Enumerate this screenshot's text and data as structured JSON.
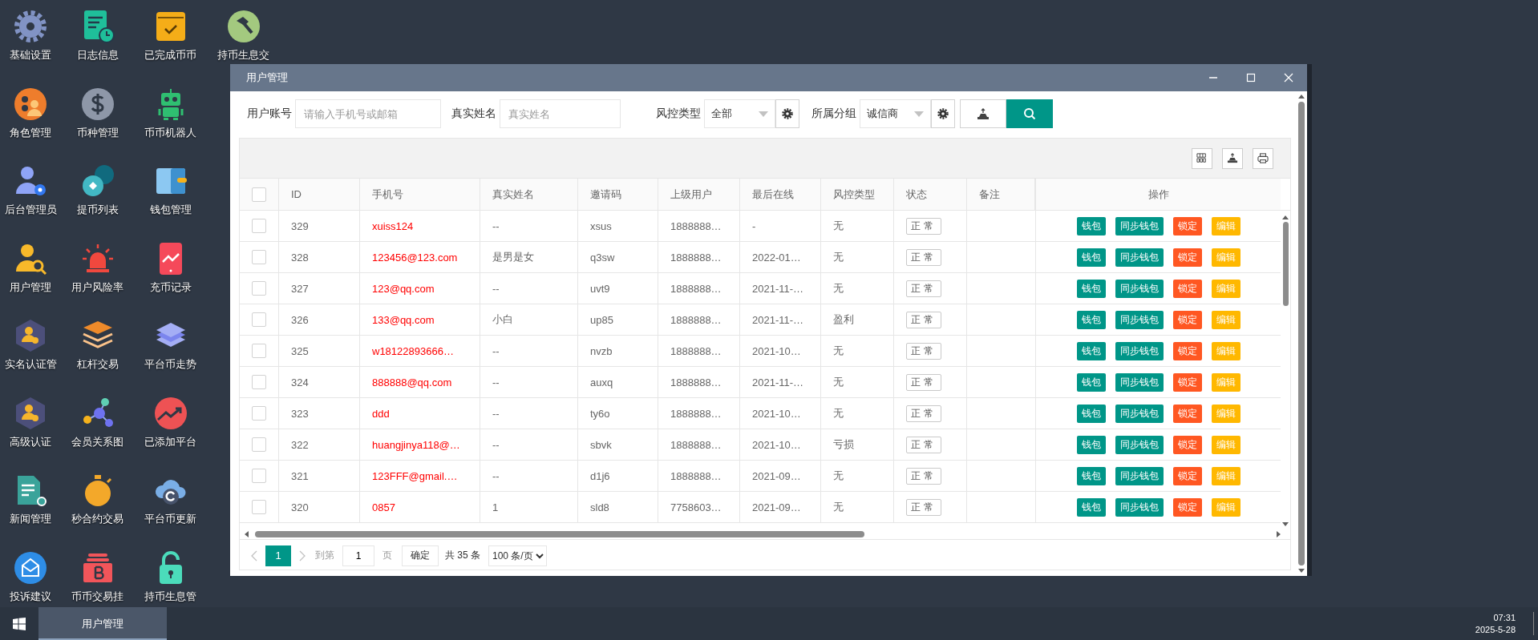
{
  "desktop_icons": [
    {
      "label": "基础设置"
    },
    {
      "label": "角色管理"
    },
    {
      "label": "后台管理员"
    },
    {
      "label": "用户管理"
    },
    {
      "label": "实名认证管"
    },
    {
      "label": "高级认证"
    },
    {
      "label": "新闻管理"
    },
    {
      "label": "投诉建议"
    },
    {
      "label": "日志信息"
    },
    {
      "label": "币种管理"
    },
    {
      "label": "提币列表"
    },
    {
      "label": "用户风险率"
    },
    {
      "label": "杠杆交易"
    },
    {
      "label": "会员关系图"
    },
    {
      "label": "秒合约交易"
    },
    {
      "label": "币币交易挂"
    },
    {
      "label": "已完成币币"
    },
    {
      "label": "币币机器人"
    },
    {
      "label": "钱包管理"
    },
    {
      "label": "充币记录"
    },
    {
      "label": "平台币走势"
    },
    {
      "label": "已添加平台"
    },
    {
      "label": "平台币更新"
    },
    {
      "label": "持币生息管"
    },
    {
      "label": "持币生息交"
    }
  ],
  "window": {
    "title": "用户管理",
    "filters": [
      {
        "kind": "text",
        "label": "用户账号",
        "placeholder": "请输入手机号或邮箱"
      },
      {
        "kind": "text",
        "label": "真实姓名",
        "placeholder": "真实姓名"
      },
      {
        "kind": "select",
        "label": "风控类型",
        "value": "全部"
      },
      {
        "kind": "select",
        "label": "所属分组",
        "value": "诚信商"
      }
    ],
    "table": {
      "columns": [
        "ID",
        "手机号",
        "真实姓名",
        "邀请码",
        "上级用户",
        "最后在线",
        "风控类型",
        "状态",
        "备注",
        "操作"
      ],
      "header_checkbox": {
        "checked": false
      },
      "rows": [
        {
          "checked": false,
          "cells": [
            "329",
            "xuiss124",
            "--",
            "xsus",
            "1888888…",
            "-",
            "无"
          ],
          "status": "正常",
          "actions": [
            {
              "label": "钱包",
              "color": "#009688"
            },
            {
              "label": "同步钱包",
              "color": "#009688"
            },
            {
              "label": "锁定",
              "color": "#ff5722"
            },
            {
              "label": "编辑",
              "color": "#ffb800"
            }
          ]
        },
        {
          "checked": false,
          "cells": [
            "328",
            "123456@123.com",
            "是男是女",
            "q3sw",
            "1888888…",
            "2022-01…",
            "无"
          ],
          "status": "正常",
          "actions": [
            {
              "label": "钱包",
              "color": "#009688"
            },
            {
              "label": "同步钱包",
              "color": "#009688"
            },
            {
              "label": "锁定",
              "color": "#ff5722"
            },
            {
              "label": "编辑",
              "color": "#ffb800"
            }
          ]
        },
        {
          "checked": false,
          "cells": [
            "327",
            "123@qq.com",
            "--",
            "uvt9",
            "1888888…",
            "2021-11-…",
            "无"
          ],
          "status": "正常",
          "actions": [
            {
              "label": "钱包",
              "color": "#009688"
            },
            {
              "label": "同步钱包",
              "color": "#009688"
            },
            {
              "label": "锁定",
              "color": "#ff5722"
            },
            {
              "label": "编辑",
              "color": "#ffb800"
            }
          ]
        },
        {
          "checked": false,
          "cells": [
            "326",
            "133@qq.com",
            "小白",
            "up85",
            "1888888…",
            "2021-11-…",
            "盈利"
          ],
          "status": "正常",
          "actions": [
            {
              "label": "钱包",
              "color": "#009688"
            },
            {
              "label": "同步钱包",
              "color": "#009688"
            },
            {
              "label": "锁定",
              "color": "#ff5722"
            },
            {
              "label": "编辑",
              "color": "#ffb800"
            }
          ]
        },
        {
          "checked": false,
          "cells": [
            "325",
            "w18122893666…",
            "--",
            "nvzb",
            "1888888…",
            "2021-10…",
            "无"
          ],
          "status": "正常",
          "actions": [
            {
              "label": "钱包",
              "color": "#009688"
            },
            {
              "label": "同步钱包",
              "color": "#009688"
            },
            {
              "label": "锁定",
              "color": "#ff5722"
            },
            {
              "label": "编辑",
              "color": "#ffb800"
            }
          ]
        },
        {
          "checked": false,
          "cells": [
            "324",
            "888888@qq.com",
            "--",
            "auxq",
            "1888888…",
            "2021-11-…",
            "无"
          ],
          "status": "正常",
          "actions": [
            {
              "label": "钱包",
              "color": "#009688"
            },
            {
              "label": "同步钱包",
              "color": "#009688"
            },
            {
              "label": "锁定",
              "color": "#ff5722"
            },
            {
              "label": "编辑",
              "color": "#ffb800"
            }
          ]
        },
        {
          "checked": false,
          "cells": [
            "323",
            "ddd",
            "--",
            "ty6o",
            "1888888…",
            "2021-10…",
            "无"
          ],
          "status": "正常",
          "actions": [
            {
              "label": "钱包",
              "color": "#009688"
            },
            {
              "label": "同步钱包",
              "color": "#009688"
            },
            {
              "label": "锁定",
              "color": "#ff5722"
            },
            {
              "label": "编辑",
              "color": "#ffb800"
            }
          ]
        },
        {
          "checked": false,
          "cells": [
            "322",
            "huangjinya118@…",
            "--",
            "sbvk",
            "1888888…",
            "2021-10…",
            "亏损"
          ],
          "status": "正常",
          "actions": [
            {
              "label": "钱包",
              "color": "#009688"
            },
            {
              "label": "同步钱包",
              "color": "#009688"
            },
            {
              "label": "锁定",
              "color": "#ff5722"
            },
            {
              "label": "编辑",
              "color": "#ffb800"
            }
          ]
        },
        {
          "checked": false,
          "cells": [
            "321",
            "123FFF@gmail.…",
            "--",
            "d1j6",
            "1888888…",
            "2021-09…",
            "无"
          ],
          "status": "正常",
          "actions": [
            {
              "label": "钱包",
              "color": "#009688"
            },
            {
              "label": "同步钱包",
              "color": "#009688"
            },
            {
              "label": "锁定",
              "color": "#ff5722"
            },
            {
              "label": "编辑",
              "color": "#ffb800"
            }
          ]
        },
        {
          "checked": false,
          "cells": [
            "320",
            "0857",
            "1",
            "sld8",
            "7758603…",
            "2021-09…",
            "无"
          ],
          "status": "正常",
          "actions": [
            {
              "label": "钱包",
              "color": "#009688"
            },
            {
              "label": "同步钱包",
              "color": "#009688"
            },
            {
              "label": "锁定",
              "color": "#ff5722"
            },
            {
              "label": "编辑",
              "color": "#ffb800"
            }
          ]
        }
      ]
    },
    "pagination": {
      "pages": [
        {
          "label": "1",
          "selected": true
        }
      ],
      "goto_label": "到第",
      "goto_value": "1",
      "page_unit": "页",
      "confirm": "确定",
      "total": "共 35 条",
      "page_size": "100 条/页"
    }
  },
  "taskbar": {
    "tasks": [
      {
        "label": "用户管理",
        "selected": true
      }
    ],
    "time": "07:31",
    "date": "2025-5-28"
  }
}
